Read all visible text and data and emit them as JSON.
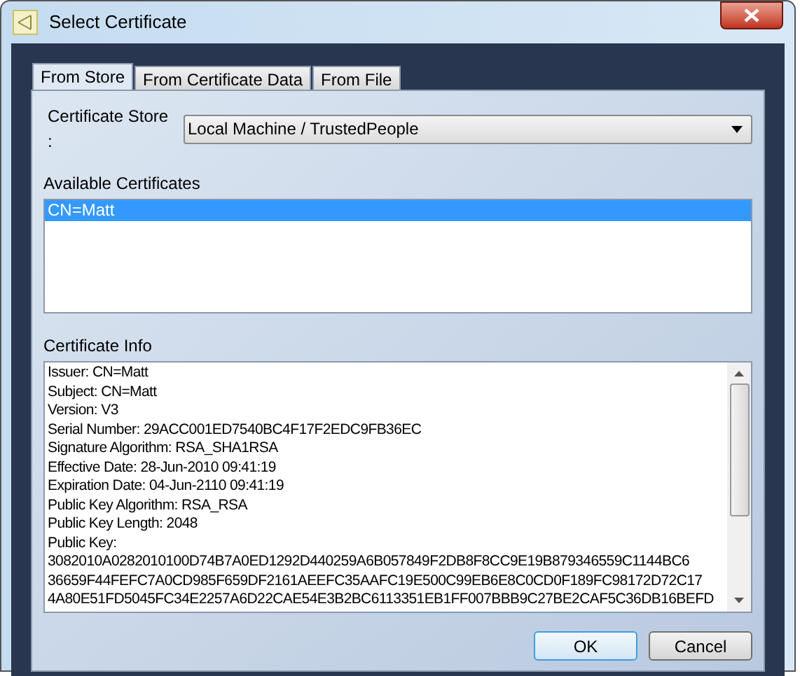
{
  "window": {
    "title": "Select Certificate"
  },
  "tabs": [
    {
      "label": "From Store",
      "selected": true
    },
    {
      "label": "From Certificate Data",
      "selected": false
    },
    {
      "label": "From File",
      "selected": false
    }
  ],
  "store": {
    "label": "Certificate Store :",
    "value": "Local Machine / TrustedPeople"
  },
  "available": {
    "label": "Available Certificates",
    "items": [
      {
        "label": "CN=Matt",
        "selected": true
      }
    ]
  },
  "info": {
    "label": "Certificate Info",
    "lines": [
      "Issuer: CN=Matt",
      "Subject: CN=Matt",
      "Version: V3",
      "Serial Number: 29ACC001ED7540BC4F17F2EDC9FB36EC",
      "Signature Algorithm: RSA_SHA1RSA",
      "Effective Date: 28-Jun-2010 09:41:19",
      "Expiration Date: 04-Jun-2110 09:41:19",
      "Public Key Algorithm: RSA_RSA",
      "Public Key Length: 2048",
      "Public Key:",
      "3082010A0282010100D74B7A0ED1292D440259A6B057849F2DB8F8CC9E19B879346559C1144BC6",
      "36659F44FEFC7A0CD985F659DF2161AEEFC35AAFC19E500C99EB6E8C0CD0F189FC98172D72C17",
      "4A80E51FD5045FC34E2257A6D22CAE54E3B2BC6113351EB1FF007BBB9C27BE2CAF5C36DB16BEFD"
    ]
  },
  "buttons": [
    {
      "label": "OK",
      "kind": "default"
    },
    {
      "label": "Cancel",
      "kind": "normal"
    }
  ]
}
